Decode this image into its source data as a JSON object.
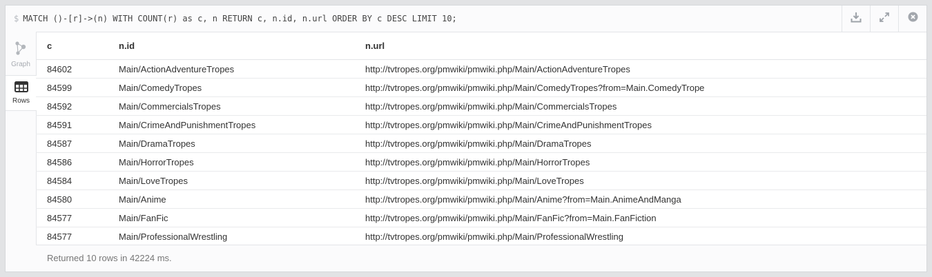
{
  "query": {
    "prompt": "$",
    "text": "MATCH ()-[r]->(n) WITH COUNT(r) as c, n RETURN c, n.id, n.url ORDER BY c DESC LIMIT 10;"
  },
  "toolbar": {
    "icons": [
      "download-icon",
      "expand-icon",
      "close-icon"
    ]
  },
  "views": {
    "graph_label": "Graph",
    "rows_label": "Rows",
    "active": "Rows"
  },
  "table": {
    "columns": [
      "c",
      "n.id",
      "n.url"
    ],
    "rows": [
      {
        "c": "84602",
        "id": "Main/ActionAdventureTropes",
        "url": "http://tvtropes.org/pmwiki/pmwiki.php/Main/ActionAdventureTropes"
      },
      {
        "c": "84599",
        "id": "Main/ComedyTropes",
        "url": "http://tvtropes.org/pmwiki/pmwiki.php/Main/ComedyTropes?from=Main.ComedyTrope"
      },
      {
        "c": "84592",
        "id": "Main/CommercialsTropes",
        "url": "http://tvtropes.org/pmwiki/pmwiki.php/Main/CommercialsTropes"
      },
      {
        "c": "84591",
        "id": "Main/CrimeAndPunishmentTropes",
        "url": "http://tvtropes.org/pmwiki/pmwiki.php/Main/CrimeAndPunishmentTropes"
      },
      {
        "c": "84587",
        "id": "Main/DramaTropes",
        "url": "http://tvtropes.org/pmwiki/pmwiki.php/Main/DramaTropes"
      },
      {
        "c": "84586",
        "id": "Main/HorrorTropes",
        "url": "http://tvtropes.org/pmwiki/pmwiki.php/Main/HorrorTropes"
      },
      {
        "c": "84584",
        "id": "Main/LoveTropes",
        "url": "http://tvtropes.org/pmwiki/pmwiki.php/Main/LoveTropes"
      },
      {
        "c": "84580",
        "id": "Main/Anime",
        "url": "http://tvtropes.org/pmwiki/pmwiki.php/Main/Anime?from=Main.AnimeAndManga"
      },
      {
        "c": "84577",
        "id": "Main/FanFic",
        "url": "http://tvtropes.org/pmwiki/pmwiki.php/Main/FanFic?from=Main.FanFiction"
      },
      {
        "c": "84577",
        "id": "Main/ProfessionalWrestling",
        "url": "http://tvtropes.org/pmwiki/pmwiki.php/Main/ProfessionalWrestling"
      }
    ]
  },
  "status": {
    "text": "Returned 10 rows in 42224 ms."
  }
}
